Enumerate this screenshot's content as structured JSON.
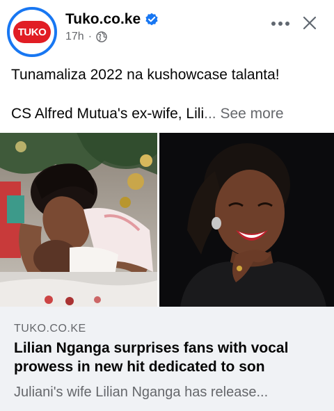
{
  "post": {
    "page_name": "Tuko.co.ke",
    "logo_text": "TUKO",
    "time": "17h",
    "separator": "·",
    "caption_line1": "Tunamaliza 2022 na kushowcase talanta!",
    "caption_line2": "CS Alfred Mutua's ex-wife, Lili",
    "ellipsis": "...",
    "see_more": "See more"
  },
  "link_preview": {
    "domain": "TUKO.CO.KE",
    "title": "Lilian Nganga surprises fans with vocal prowess in new hit dedicated to son",
    "description": "Juliani's wife Lilian Nganga has release..."
  },
  "icons": {
    "verified": "verified-badge-icon",
    "audience": "globe-icon",
    "more": "more-options-icon",
    "close": "close-icon"
  },
  "colors": {
    "brand_red": "#e11d24",
    "facebook_blue": "#1877f2",
    "secondary_text": "#65676b",
    "card_background": "#f0f2f5"
  }
}
